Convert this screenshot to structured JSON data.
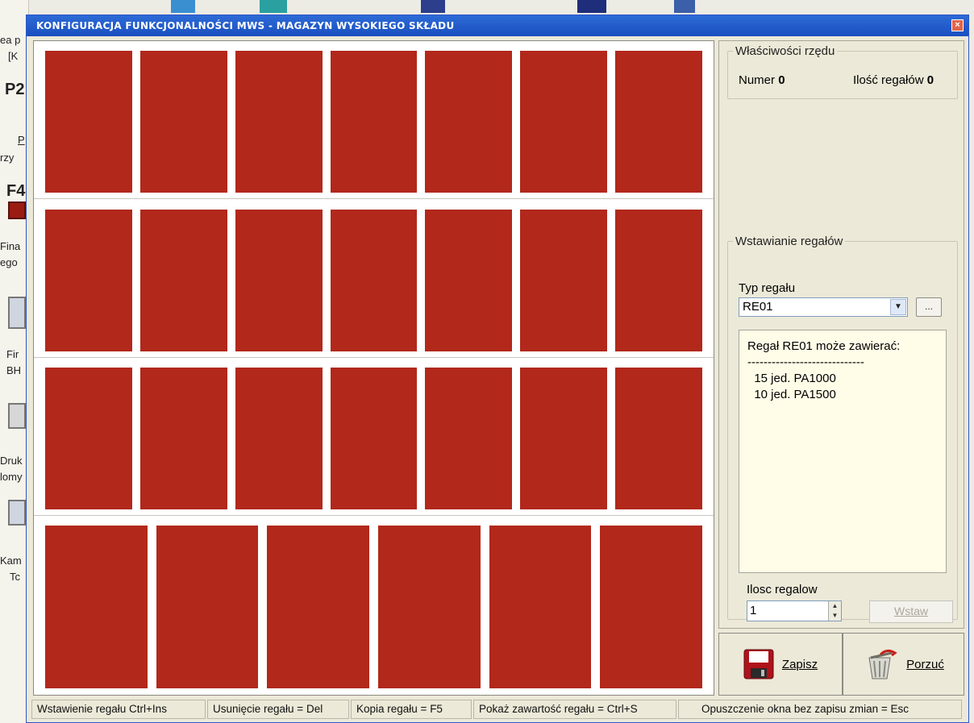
{
  "window": {
    "title": "KONFIGURACJA FUNKCJONALNOŚCI MWS - MAGAZYN WYSOKIEGO SKŁADU",
    "close_label": "×"
  },
  "desktop_fragments": [
    "ea p",
    "[K",
    "P2",
    "P",
    "rzy",
    "F4",
    "Fina",
    "ego",
    "Fir",
    "BH",
    "Druk",
    "lomy",
    "Kam",
    "Tc"
  ],
  "colors": {
    "rack": "#b2281b",
    "title_bar": "#2160cf",
    "memo_bg": "#fffde8",
    "window_bg": "#ece9d8"
  },
  "grid": {
    "rows": [
      {
        "rack_count": 7
      },
      {
        "rack_count": 7
      },
      {
        "rack_count": 7
      },
      {
        "rack_count": 6
      }
    ]
  },
  "row_properties": {
    "legend": "Właściwości rzędu",
    "numer_label": "Numer",
    "numer_value": "0",
    "count_label": "Ilość regałów",
    "count_value": "0"
  },
  "insert": {
    "legend": "Wstawianie regałów",
    "type_label": "Typ regału",
    "type_value": "RE01",
    "browse_label": "...",
    "memo": [
      "Regał RE01 może zawierać:",
      "-----------------------------",
      "  15 jed. PA1000",
      "  10 jed. PA1500"
    ],
    "count_label": "Ilosc regalow",
    "count_value": "1",
    "insert_button": "Wstaw"
  },
  "actions": {
    "save_label": "Zapisz",
    "cancel_label": "Porzuć"
  },
  "status_bar": [
    "Wstawienie regału  Ctrl+Ins",
    "Usunięcie regału = Del",
    "Kopia regału = F5",
    "Pokaż zawartość regału = Ctrl+S",
    "Opuszczenie okna bez zapisu zmian = Esc"
  ]
}
